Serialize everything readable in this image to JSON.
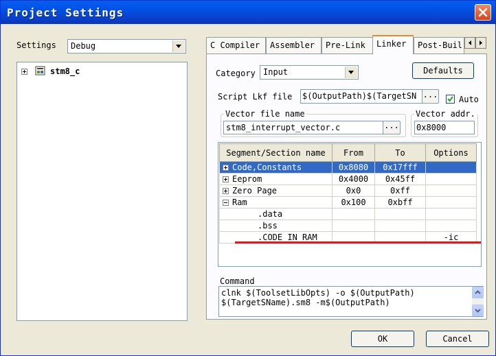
{
  "window": {
    "title": "Project Settings"
  },
  "settings": {
    "label": "Settings",
    "value": "Debug"
  },
  "tree": {
    "root_label": "stm8_c"
  },
  "tabs": [
    {
      "label": "C Compiler"
    },
    {
      "label": "Assembler"
    },
    {
      "label": "Pre-Link"
    },
    {
      "label": "Linker"
    },
    {
      "label": "Post-Buil"
    }
  ],
  "linker": {
    "category_label": "Category",
    "category_value": "Input",
    "defaults_label": "Defaults",
    "script_label": "Script Lkf file",
    "script_value": "$(OutputPath)$(TargetSN",
    "browse_label": "...",
    "auto_label": "Auto",
    "auto_checked": true,
    "vector_file_label": "Vector file name",
    "vector_file_value": "stm8_interrupt_vector.c",
    "vector_addr_label": "Vector addr.",
    "vector_addr_value": "0x8000",
    "columns": [
      "Segment/Section name",
      "From",
      "To",
      "Options"
    ],
    "rows": [
      {
        "name": "Code,Constants",
        "from": "0x8080",
        "to": "0x17fff",
        "options": "",
        "expander": "+"
      },
      {
        "name": "Eeprom",
        "from": "0x4000",
        "to": "0x45ff",
        "options": "",
        "expander": "+"
      },
      {
        "name": "Zero Page",
        "from": "0x0",
        "to": "0xff",
        "options": "",
        "expander": "+"
      },
      {
        "name": "Ram",
        "from": "0x100",
        "to": "0xbff",
        "options": "",
        "expander": "-"
      },
      {
        "name": ".data",
        "from": "",
        "to": "",
        "options": ""
      },
      {
        "name": ".bss",
        "from": "",
        "to": "",
        "options": ""
      },
      {
        "name": ".CODE_IN_RAM",
        "from": "",
        "to": "",
        "options": "-ic"
      }
    ],
    "command_label": "Command",
    "command_line1": "clnk $(ToolsetLibOpts) -o $(OutputPath)",
    "command_line2": "$(TargetSName).sm8 -m$(OutputPath)"
  },
  "buttons": {
    "ok": "OK",
    "cancel": "Cancel"
  },
  "colors": {
    "titlebar": "#0a3fc8",
    "selection": "#316ac5",
    "annotation_line": "#e0161b",
    "active_tab_accent": "#e68b2c"
  }
}
